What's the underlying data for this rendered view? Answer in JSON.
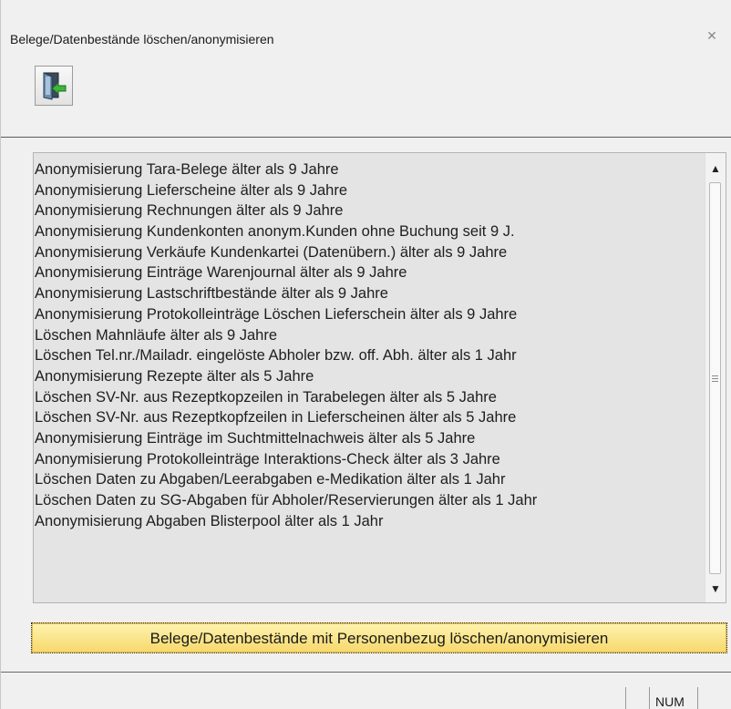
{
  "window": {
    "title": "Belege/Datenbestände löschen/anonymisieren",
    "close_icon": "close-icon"
  },
  "toolbar": {
    "exit_icon": "exit-door-icon"
  },
  "list": {
    "items": [
      "Anonymisierung Tara-Belege älter als 9 Jahre",
      "Anonymisierung Lieferscheine älter als 9 Jahre",
      "Anonymisierung Rechnungen älter als 9 Jahre",
      "Anonymisierung Kundenkonten anonym.Kunden ohne Buchung seit 9 J.",
      "Anonymisierung Verkäufe Kundenkartei (Datenübern.) älter als 9 Jahre",
      "Anonymisierung Einträge Warenjournal älter als 9 Jahre",
      "Anonymisierung Lastschriftbestände älter als 9 Jahre",
      "Anonymisierung Protokolleinträge Löschen Lieferschein älter als 9 Jahre",
      "Löschen Mahnläufe älter als 9 Jahre",
      "Löschen Tel.nr./Mailadr. eingelöste Abholer bzw. off. Abh. älter als 1 Jahr",
      "Anonymisierung Rezepte älter als 5 Jahre",
      "Löschen SV-Nr. aus Rezeptkopzeilen in Tarabelegen älter als 5 Jahre",
      "Löschen SV-Nr. aus Rezeptkopfzeilen in Lieferscheinen älter als 5 Jahre",
      "Anonymisierung Einträge im Suchtmittelnachweis älter als 5 Jahre",
      "Anonymisierung Protokolleinträge Interaktions-Check älter als 3 Jahre",
      "Löschen Daten zu Abgaben/Leerabgaben e-Medikation älter als 1 Jahr",
      "Löschen Daten zu SG-Abgaben für Abholer/Reservierungen älter als 1 Jahr",
      "Anonymisierung Abgaben Blisterpool älter als 1 Jahr"
    ]
  },
  "action_button": {
    "label": "Belege/Datenbestände mit Personenbezug löschen/anonymisieren"
  },
  "statusbar": {
    "num": "NUM"
  },
  "colors": {
    "list_bg": "#e4e4e4",
    "button_bg": "#f7d86a",
    "window_bg": "#f0f0f0"
  }
}
